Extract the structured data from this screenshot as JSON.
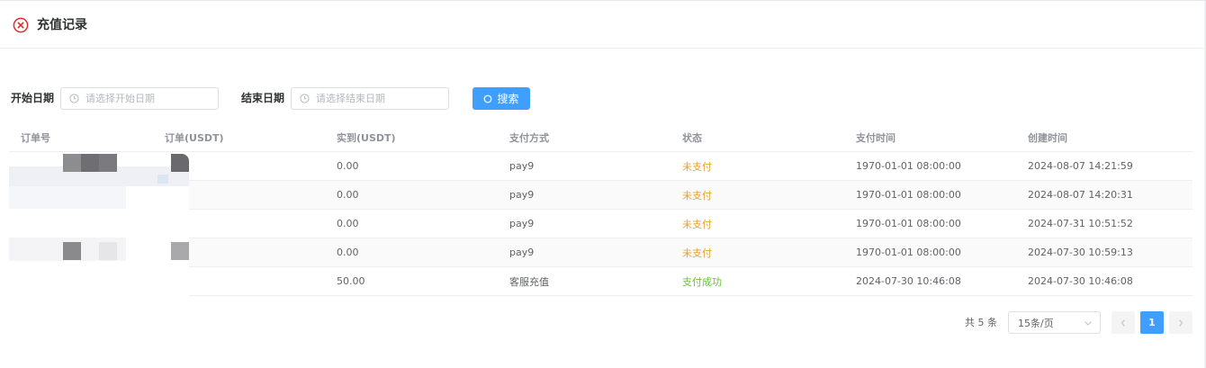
{
  "header": {
    "title": "充值记录"
  },
  "filters": {
    "start_label": "开始日期",
    "start_placeholder": "请选择开始日期",
    "end_label": "结束日期",
    "end_placeholder": "请选择结束日期",
    "search_label": "搜索"
  },
  "table": {
    "columns": [
      "订单号",
      "订单(USDT)",
      "实到(USDT)",
      "支付方式",
      "状态",
      "支付时间",
      "创建时间"
    ],
    "rows": [
      {
        "actual": "0.00",
        "method": "pay9",
        "status": "未支付",
        "paid_at": "1970-01-01 08:00:00",
        "created_at": "2024-08-07 14:21:59"
      },
      {
        "actual": "0.00",
        "method": "pay9",
        "status": "未支付",
        "paid_at": "1970-01-01 08:00:00",
        "created_at": "2024-08-07 14:20:31"
      },
      {
        "actual": "0.00",
        "method": "pay9",
        "status": "未支付",
        "paid_at": "1970-01-01 08:00:00",
        "created_at": "2024-07-31 10:51:52"
      },
      {
        "actual": "0.00",
        "method": "pay9",
        "status": "未支付",
        "paid_at": "1970-01-01 08:00:00",
        "created_at": "2024-07-30 10:59:13"
      },
      {
        "actual": "50.00",
        "method": "客服充值",
        "status": "支付成功",
        "paid_at": "2024-07-30 10:46:08",
        "created_at": "2024-07-30 10:46:08"
      }
    ]
  },
  "pagination": {
    "total": "共 5 条",
    "page_size": "15条/页",
    "current_page": "1"
  },
  "colors": {
    "primary": "#409eff",
    "unpaid": "#e6a23c",
    "success": "#67c23a",
    "close_icon": "#e02b2b"
  },
  "icons": [
    "close-circle-icon",
    "clock-icon",
    "search-icon",
    "chevron-down-icon",
    "chevron-left-icon",
    "chevron-right-icon"
  ]
}
